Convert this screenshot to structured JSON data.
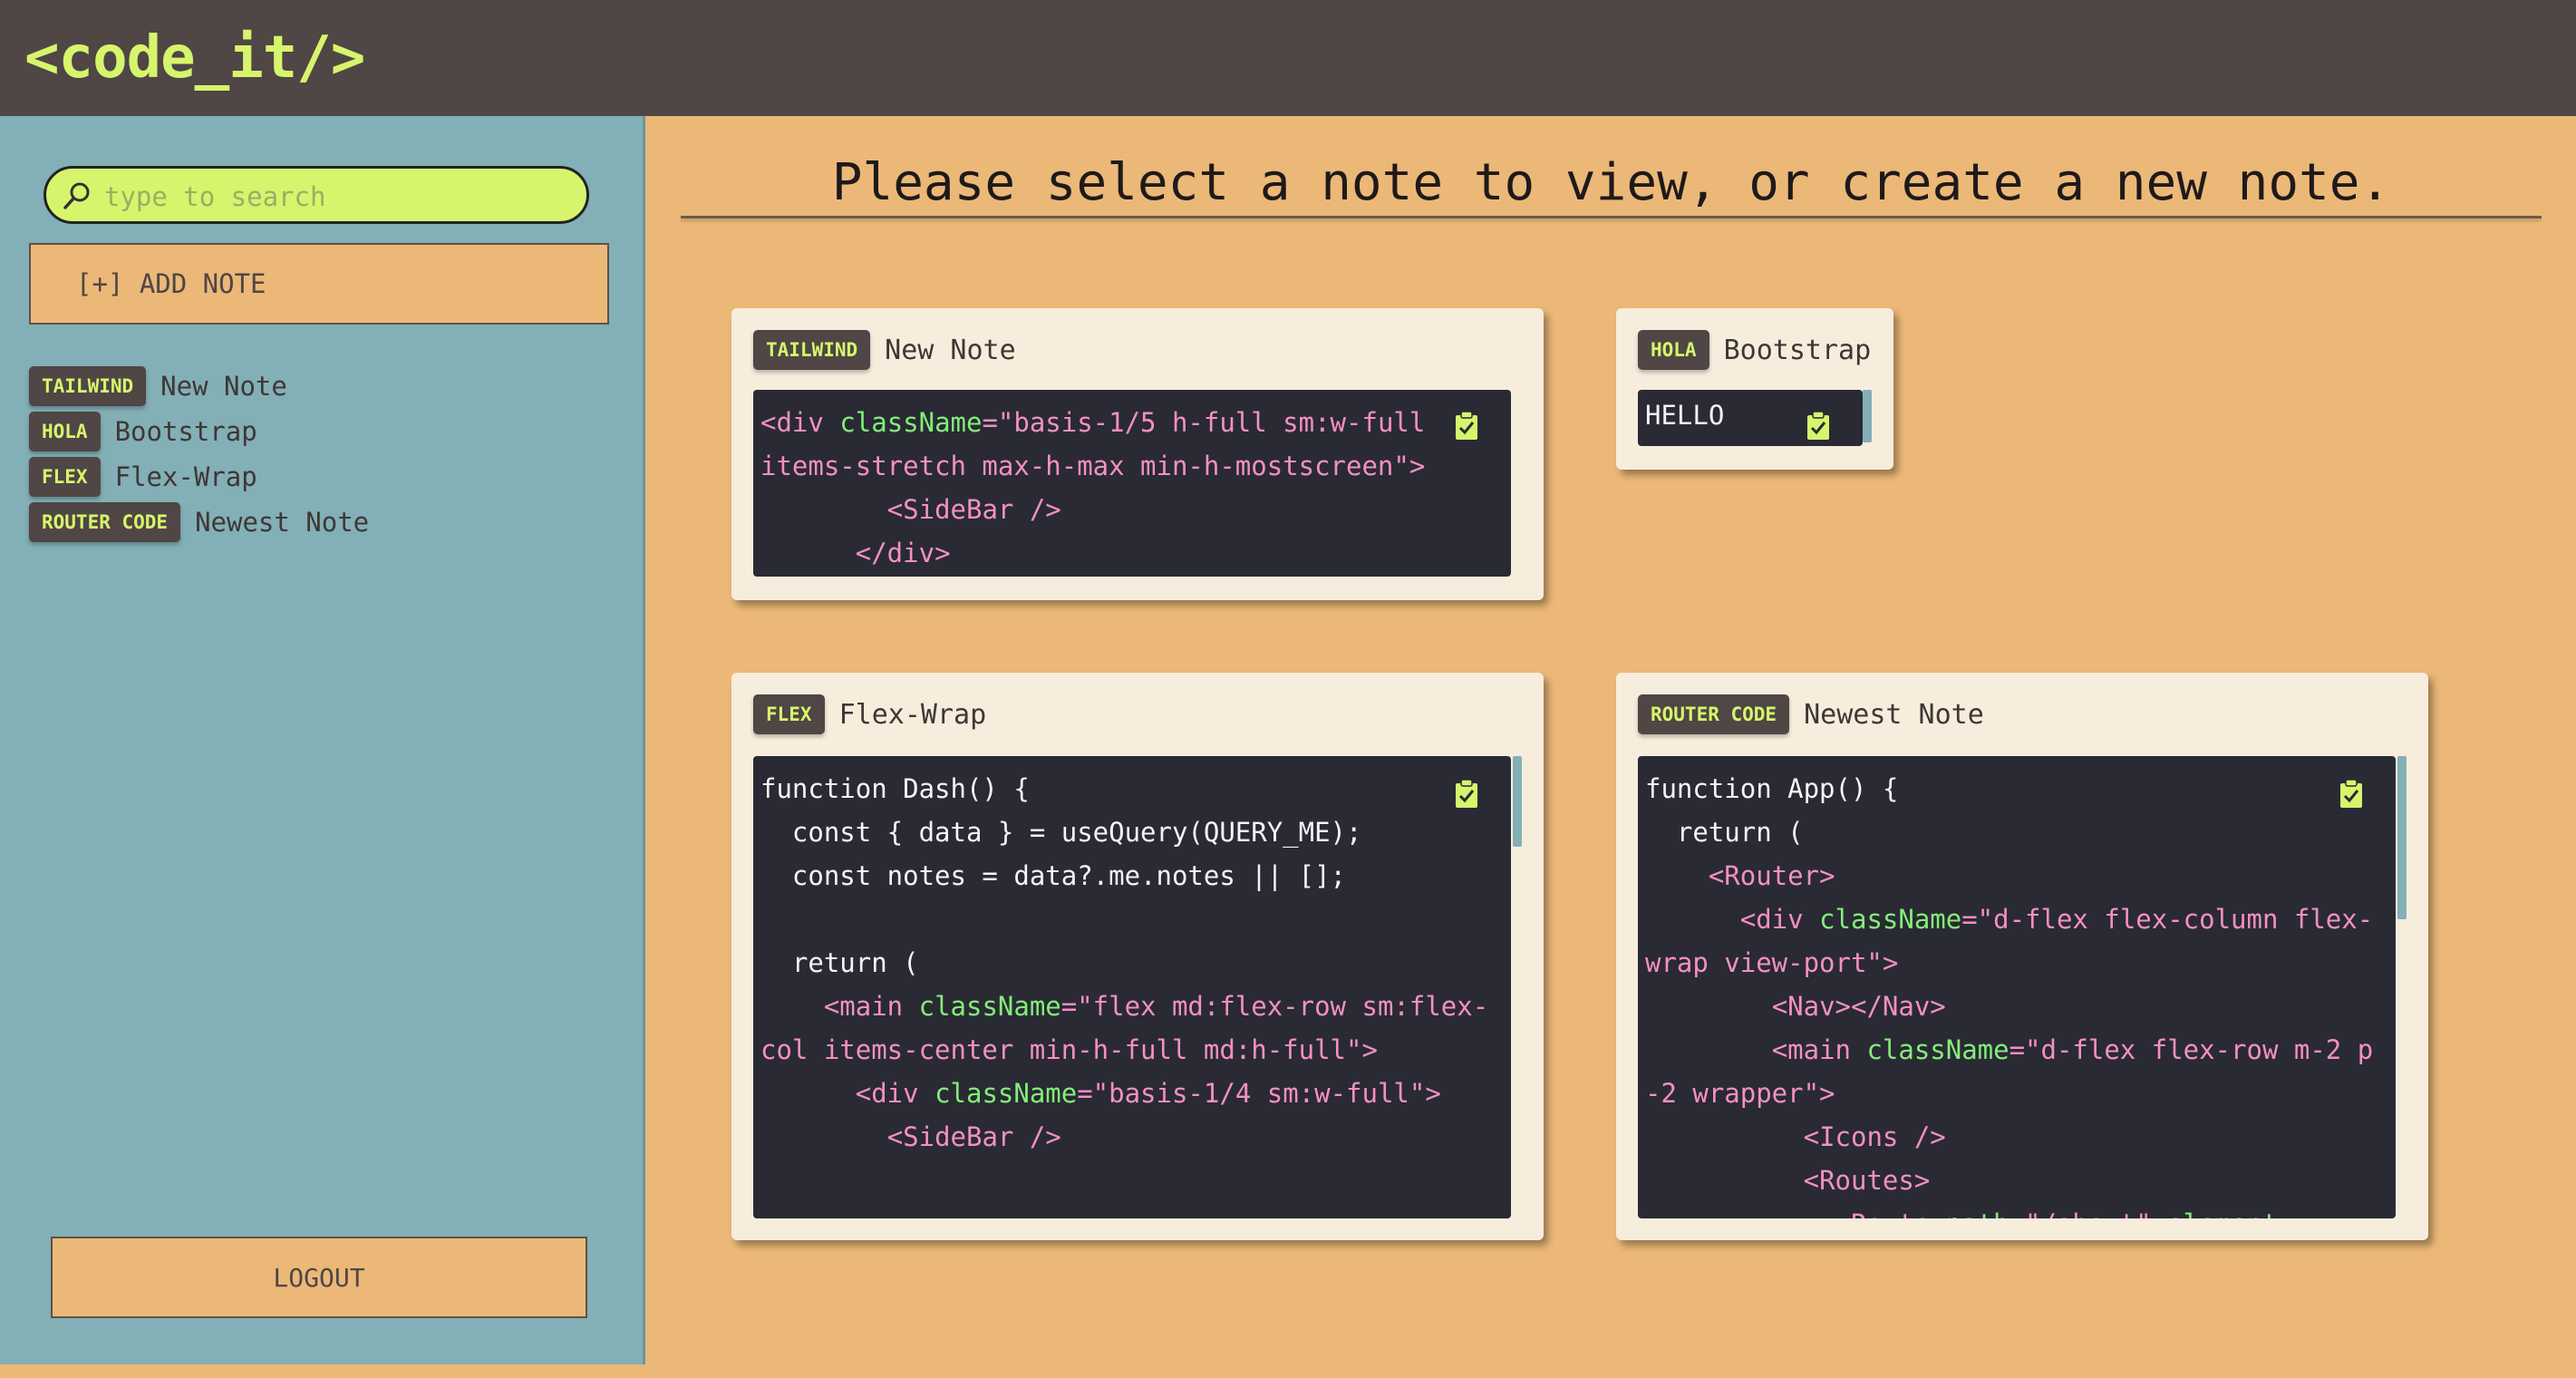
{
  "header": {
    "logo": "<code_it/>"
  },
  "sidebar": {
    "search_placeholder": "type to search",
    "add_note_label": "[+] ADD NOTE",
    "notes": [
      {
        "tag": "TAILWIND",
        "title": "New Note"
      },
      {
        "tag": "HOLA",
        "title": "Bootstrap"
      },
      {
        "tag": "FLEX",
        "title": "Flex-Wrap"
      },
      {
        "tag": "ROUTER CODE",
        "title": "Newest Note"
      }
    ],
    "logout_label": "LOGOUT"
  },
  "main": {
    "prompt": "Please select a note to view, or create a new note.",
    "cards": [
      {
        "tag": "TAILWIND",
        "title": "New Note",
        "code": [
          [
            [
              "tagc",
              "<div "
            ],
            [
              "attr",
              "className"
            ],
            [
              "tagc",
              "=\"basis-1/5 h-full sm:w-full"
            ]
          ],
          [
            [
              "tagc",
              "items-stretch max-h-max min-h-mostscreen\">"
            ]
          ],
          [
            [
              "tagc",
              "        <SideBar />"
            ]
          ],
          [
            [
              "tagc",
              "      </div>"
            ]
          ]
        ]
      },
      {
        "tag": "HOLA",
        "title": "Bootstrap",
        "code": [
          [
            [
              "plain",
              "HELLO"
            ]
          ]
        ]
      },
      {
        "tag": "FLEX",
        "title": "Flex-Wrap",
        "code": [
          [
            [
              "plain",
              "function Dash() {"
            ]
          ],
          [
            [
              "plain",
              "  const { data } = useQuery(QUERY_ME);"
            ]
          ],
          [
            [
              "plain",
              "  const notes = data?.me.notes || [];"
            ]
          ],
          [
            [
              "plain",
              ""
            ]
          ],
          [
            [
              "plain",
              "  return ("
            ]
          ],
          [
            [
              "tagc",
              "    <main "
            ],
            [
              "attr",
              "className"
            ],
            [
              "tagc",
              "=\"flex md:flex-row sm:flex-col items-center min-h-full md:h-full\">"
            ]
          ],
          [
            [
              "tagc",
              "      <div "
            ],
            [
              "attr",
              "className"
            ],
            [
              "tagc",
              "=\"basis-1/4 sm:w-full\">"
            ]
          ],
          [
            [
              "tagc",
              "        <SideBar />"
            ]
          ]
        ]
      },
      {
        "tag": "ROUTER CODE",
        "title": "Newest Note",
        "code": [
          [
            [
              "plain",
              "function App() {"
            ]
          ],
          [
            [
              "plain",
              "  return ("
            ]
          ],
          [
            [
              "tagc",
              "    <Router>"
            ]
          ],
          [
            [
              "tagc",
              "      <div "
            ],
            [
              "attr",
              "className"
            ],
            [
              "tagc",
              "=\"d-flex flex-column flex-wrap view-port\">"
            ]
          ],
          [
            [
              "tagc",
              "        <Nav></Nav>"
            ]
          ],
          [
            [
              "tagc",
              "        <main "
            ],
            [
              "attr",
              "className"
            ],
            [
              "tagc",
              "=\"d-flex flex-row m-2 p-2 wrapper\">"
            ]
          ],
          [
            [
              "tagc",
              "          <Icons />"
            ]
          ],
          [
            [
              "tagc",
              "          <Routes>"
            ]
          ],
          [
            [
              "tagc",
              "            <Route "
            ],
            [
              "attr",
              "path"
            ],
            [
              "tagc",
              "=\"/about\" "
            ],
            [
              "attr",
              "element"
            ],
            [
              "tagc",
              "="
            ]
          ]
        ]
      }
    ]
  }
}
